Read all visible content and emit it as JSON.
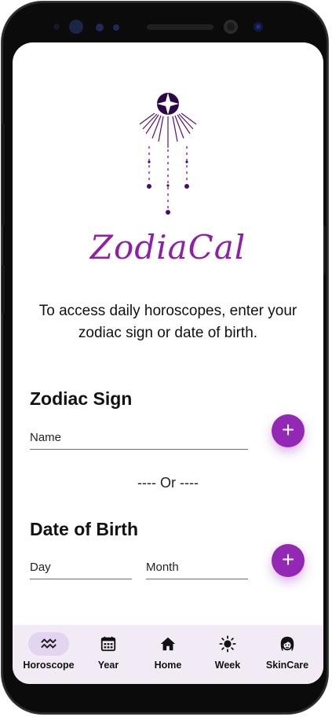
{
  "app": {
    "brand": "ZodiaCal",
    "intro": "To access daily horoscopes, enter your zodiac sign or date of birth.",
    "accent_color": "#8f1ea9"
  },
  "zodiac_section": {
    "title": "Zodiac Sign",
    "name_label": "Name",
    "add_icon": "+"
  },
  "separator": "---- Or  ----",
  "dob_section": {
    "title": "Date of Birth",
    "day_label": "Day",
    "month_label": "Month",
    "add_icon": "+"
  },
  "nav": {
    "items": [
      {
        "label": "Horoscope",
        "icon": "aquarius-icon",
        "active": true
      },
      {
        "label": "Year",
        "icon": "calendar-icon",
        "active": false
      },
      {
        "label": "Home",
        "icon": "home-icon",
        "active": false
      },
      {
        "label": "Week",
        "icon": "sun-icon",
        "active": false
      },
      {
        "label": "SkinCare",
        "icon": "face-icon",
        "active": false
      }
    ]
  }
}
